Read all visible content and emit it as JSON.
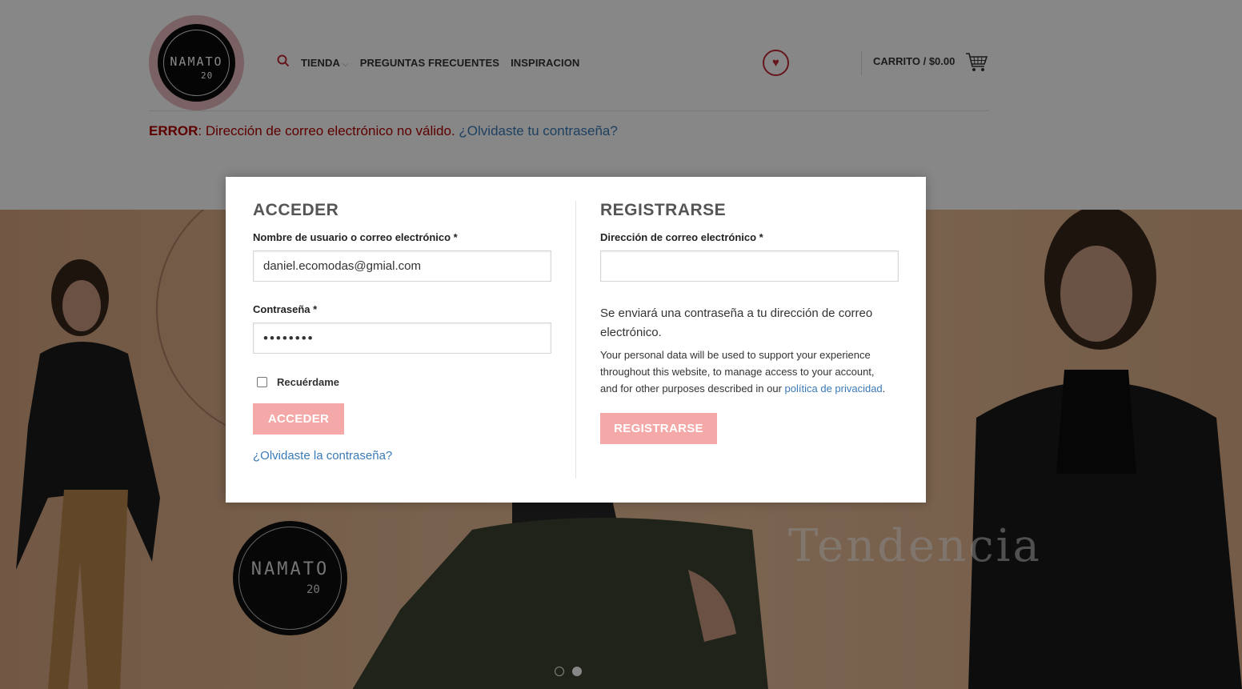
{
  "header": {
    "logo": {
      "name": "NAMATO",
      "number": "20"
    },
    "nav": [
      {
        "label": "TIENDA",
        "has_dropdown": true
      },
      {
        "label": "PREGUNTAS FRECUENTES"
      },
      {
        "label": "INSPIRACION"
      }
    ],
    "cart_label": "CARRITO / $0.00"
  },
  "error": {
    "prefix": "ERROR",
    "message": ": Dirección de correo electrónico no válido. ",
    "link": "¿Olvidaste tu contraseña?"
  },
  "hero": {
    "logo_name": "NAMATO",
    "logo_number": "20",
    "caption": "Tendencia"
  },
  "login": {
    "title": "ACCEDER",
    "username_label": "Nombre de usuario o correo electrónico *",
    "username_value": "daniel.ecomodas@gmial.com",
    "password_label": "Contraseña *",
    "password_value": "••••••••",
    "remember_label": "Recuérdame",
    "submit_label": "ACCEDER",
    "lost_password": "¿Olvidaste la contraseña?"
  },
  "register": {
    "title": "REGISTRARSE",
    "email_label": "Dirección de correo electrónico *",
    "email_value": "",
    "notice": "Se enviará una contraseña a tu dirección de correo electrónico.",
    "privacy_text": "Your personal data will be used to support your experience throughout this website, to manage access to your account, and for other purposes described in our ",
    "privacy_link": "política de privacidad",
    "privacy_end": ".",
    "submit_label": "REGISTRARSE"
  },
  "colors": {
    "accent": "#c02a35",
    "button": "#f4a9a8",
    "link": "#3a7ab8",
    "error": "#b20000"
  }
}
